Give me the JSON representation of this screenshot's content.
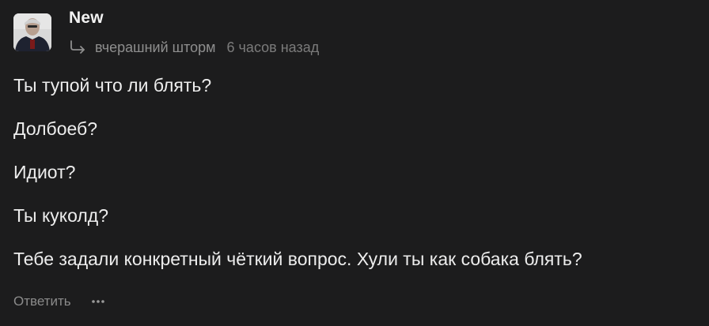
{
  "comment": {
    "author": "New",
    "reply_to": "вчерашний шторм",
    "time": "6 часов назад",
    "paragraphs": [
      "Ты тупой что ли блять?",
      "Долбоеб?",
      "Идиот?",
      "Ты куколд?",
      "Тебе задали конкретный чёткий вопрос. Хули ты как собака блять?"
    ],
    "actions": {
      "reply_label": "Ответить"
    }
  },
  "icons": {
    "reply": "reply-arrow-icon",
    "more": "more-dots-icon"
  },
  "colors": {
    "background": "#1c1c1d",
    "text": "#ededed",
    "muted": "#8e8e8e"
  }
}
